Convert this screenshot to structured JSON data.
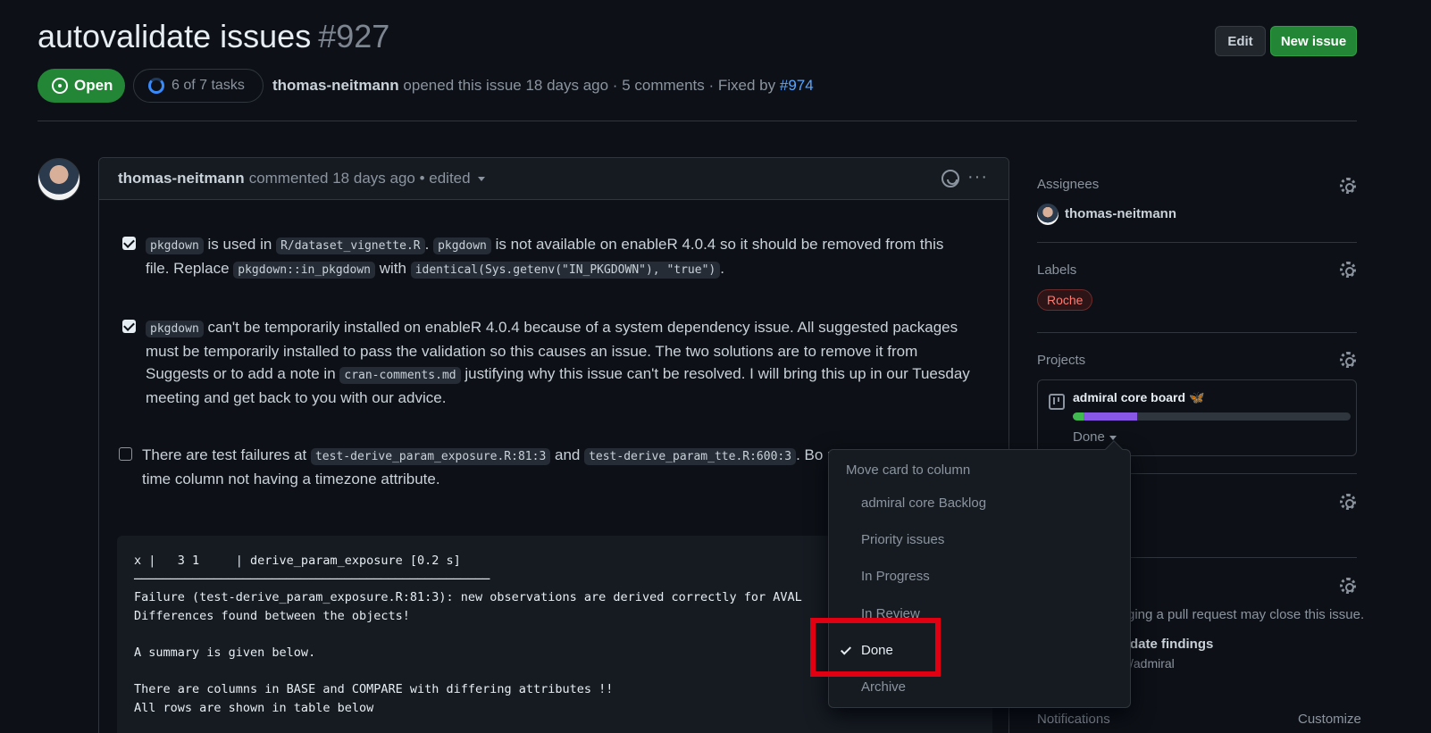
{
  "issue": {
    "title": "autovalidate issues",
    "number": "#927",
    "state": "Open",
    "tasks": "6 of 7 tasks",
    "author": "thomas-neitmann",
    "meta_text": "opened this issue 18 days ago · 5 comments · Fixed by",
    "fixed_by": "#974"
  },
  "header_buttons": {
    "edit": "Edit",
    "new_issue": "New issue"
  },
  "comment": {
    "author": "thomas-neitmann",
    "meta": "commented 18 days ago • edited",
    "tasks": [
      {
        "checked": true,
        "parts": [
          {
            "code": "pkgdown"
          },
          {
            "text": " is used in "
          },
          {
            "code": "R/dataset_vignette.R"
          },
          {
            "text": ". "
          },
          {
            "code": "pkgdown"
          },
          {
            "text": " is not available on enableR 4.0.4 so it should be removed from this file. Replace "
          },
          {
            "code": "pkgdown::in_pkgdown"
          },
          {
            "text": " with "
          },
          {
            "code": "identical(Sys.getenv(\"IN_PKGDOWN\"), \"true\")"
          },
          {
            "text": "."
          }
        ]
      },
      {
        "checked": true,
        "parts": [
          {
            "code": "pkgdown"
          },
          {
            "text": " can't be temporarily installed on enableR 4.0.4 because of a system dependency issue. All suggested packages must be temporarily installed to pass the validation so this causes an issue. The two solutions are to remove it from Suggests or to add a note in "
          },
          {
            "code": "cran-comments.md"
          },
          {
            "text": " justifying why this issue can't be resolved. I will bring this up in our Tuesday meeting and get back to you with our advice."
          }
        ]
      },
      {
        "checked": false,
        "parts": [
          {
            "text": "There are test failures at "
          },
          {
            "code": "test-derive_param_exposure.R:81:3"
          },
          {
            "text": " and "
          },
          {
            "code": "test-derive_param_tte.R:600:3"
          },
          {
            "text": ". Bo"
          },
          {
            "text": " problem of a date-time column not having a timezone attribute."
          }
        ]
      }
    ],
    "code_block": "x |   3 1     | derive_param_exposure [0.2 s]\n─────────────────────────────────────────────────\nFailure (test-derive_param_exposure.R:81:3): new observations are derived correctly for AVAL\nDifferences found between the objects!\n\nA summary is given below.\n\nThere are columns in BASE and COMPARE with differing attributes !!\nAll rows are shown in table below"
  },
  "sidebar": {
    "assignees_label": "Assignees",
    "assignee": "thomas-neitmann",
    "labels_label": "Labels",
    "label": "Roche",
    "projects_label": "Projects",
    "project_name": "admiral core board",
    "project_emoji": "🦋",
    "project_column": "Done",
    "project_progress": {
      "done": 0.04,
      "in_progress": 0.19
    },
    "dev_note": "ging a pull request may close this issue.",
    "linked_pr": "date findings",
    "linked_repo": "/admiral",
    "notifications_label": "Notifications",
    "customize": "Customize"
  },
  "dropdown": {
    "title": "Move card to column",
    "items": [
      "admiral core Backlog",
      "Priority issues",
      "In Progress",
      "In Review",
      "Done",
      "Archive"
    ],
    "selected": "Done"
  },
  "colors": {
    "accent_green": "#238636",
    "link": "#58a6ff",
    "highlight_box": "#e00012"
  }
}
